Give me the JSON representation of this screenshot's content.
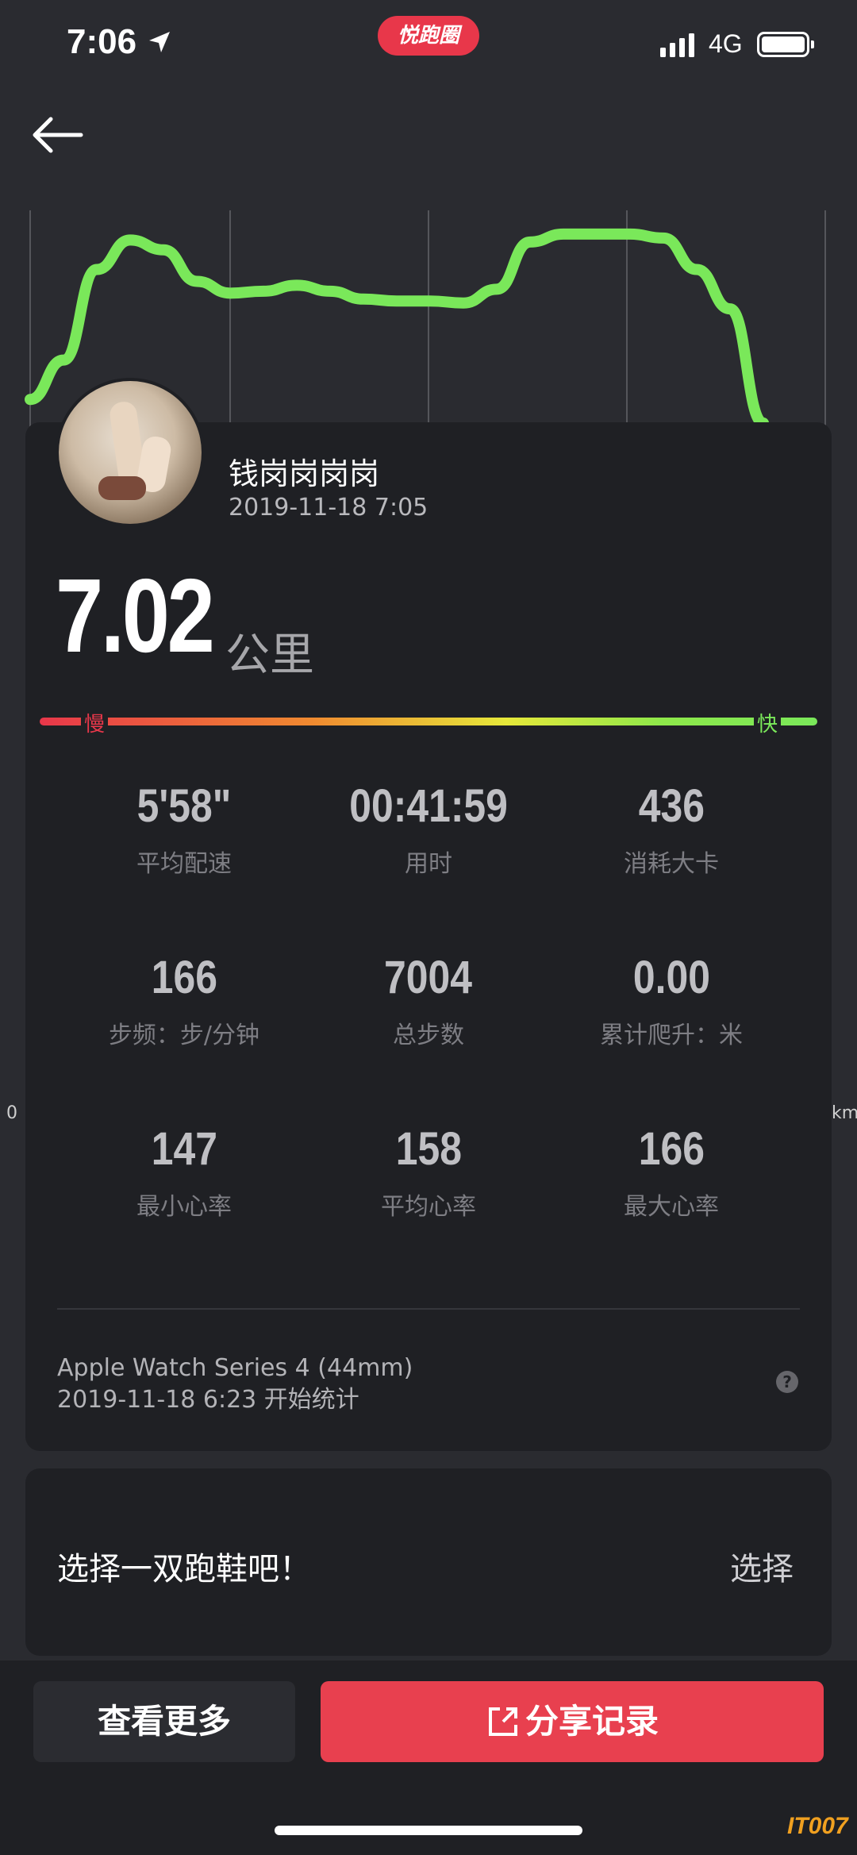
{
  "status_bar": {
    "time": "7:06",
    "network": "4G",
    "app_badge": "悦跑圈"
  },
  "chart_data": {
    "type": "line",
    "xlabel": "",
    "ylabel": "",
    "x_left_label": "0",
    "x_right_label": "km",
    "values": [
      0.12,
      0.32,
      0.78,
      0.93,
      0.88,
      0.72,
      0.66,
      0.67,
      0.7,
      0.67,
      0.63,
      0.62,
      0.62,
      0.61,
      0.68,
      0.92,
      0.96,
      0.96,
      0.96,
      0.94,
      0.78,
      0.58,
      0.0
    ],
    "color": "#7ae85a"
  },
  "profile": {
    "name": "钱岗岗岗岗",
    "date": "2019-11-18 7:05"
  },
  "summary": {
    "distance": "7.02",
    "unit": "公里"
  },
  "pace_legend": {
    "slow": "慢",
    "fast": "快"
  },
  "stats": [
    {
      "value": "5'58\"",
      "label": "平均配速"
    },
    {
      "value": "00:41:59",
      "label": "用时"
    },
    {
      "value": "436",
      "label": "消耗大卡"
    },
    {
      "value": "166",
      "label": "步频：步/分钟"
    },
    {
      "value": "7004",
      "label": "总步数"
    },
    {
      "value": "0.00",
      "label": "累计爬升：米"
    },
    {
      "value": "147",
      "label": "最小心率"
    },
    {
      "value": "158",
      "label": "平均心率"
    },
    {
      "value": "166",
      "label": "最大心率"
    }
  ],
  "device": {
    "name": "Apple Watch Series 4 (44mm)",
    "start": "2019-11-18 6:23 开始统计",
    "help": "?"
  },
  "shoe": {
    "prompt": "选择一双跑鞋吧！",
    "action": "选择"
  },
  "actions": {
    "more": "查看更多",
    "share": "分享记录"
  },
  "watermark": "IT007"
}
